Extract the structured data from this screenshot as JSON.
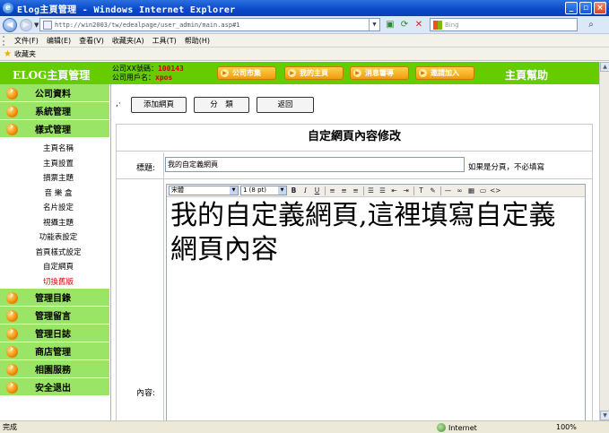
{
  "window": {
    "title": "Elog主頁管理 - Windows Internet Explorer"
  },
  "browser": {
    "url": "http://win2003/tw/edealpage/user_admin/main.asp#1",
    "search_placeholder": "Bing",
    "menu": [
      "文件(F)",
      "编辑(E)",
      "查看(V)",
      "收藏夹(A)",
      "工具(T)",
      "帮助(H)"
    ],
    "favorites_label": "收藏夹",
    "status_text": "完成",
    "zone_text": "Internet",
    "zoom": "100%"
  },
  "header": {
    "logo": "ELOG主頁管理",
    "account_label": "公司XX號碼：",
    "account_value": "100143",
    "user_label": "公司用戶名：",
    "user_value": "xpos",
    "help": "主頁幫助",
    "tabs": [
      "公司市集",
      "我的主頁",
      "消息響導",
      "邀請加入"
    ]
  },
  "sidebar": {
    "sections_top": [
      "公司資料",
      "系統管理",
      "樣式管理"
    ],
    "sub_items": [
      "主頁名稱",
      "主頁設置",
      "損票主題",
      "音 樂 盒",
      "名片設定",
      "視攝主題",
      "功能表設定",
      "首頁樣式設定",
      "自定網頁"
    ],
    "active_item": "切換舊版",
    "sections_bottom": [
      "管理目錄",
      "管理留言",
      "管理日誌",
      "商店管理",
      "相園服務",
      "安全退出"
    ]
  },
  "main": {
    "comma": ",·",
    "buttons": {
      "add": "添加網頁",
      "category": "分　類",
      "back": "返回"
    },
    "panel_title": "自定網頁內容修改",
    "title_label": "標題:",
    "title_value": "我的自定義網頁",
    "title_hint": "如果是分頁，不必填寫",
    "content_label": "內容:",
    "editor": {
      "font": "宋體",
      "size": "1 (8 pt)",
      "content": "我的自定義網頁,這裡填寫自定義網頁內容"
    }
  }
}
